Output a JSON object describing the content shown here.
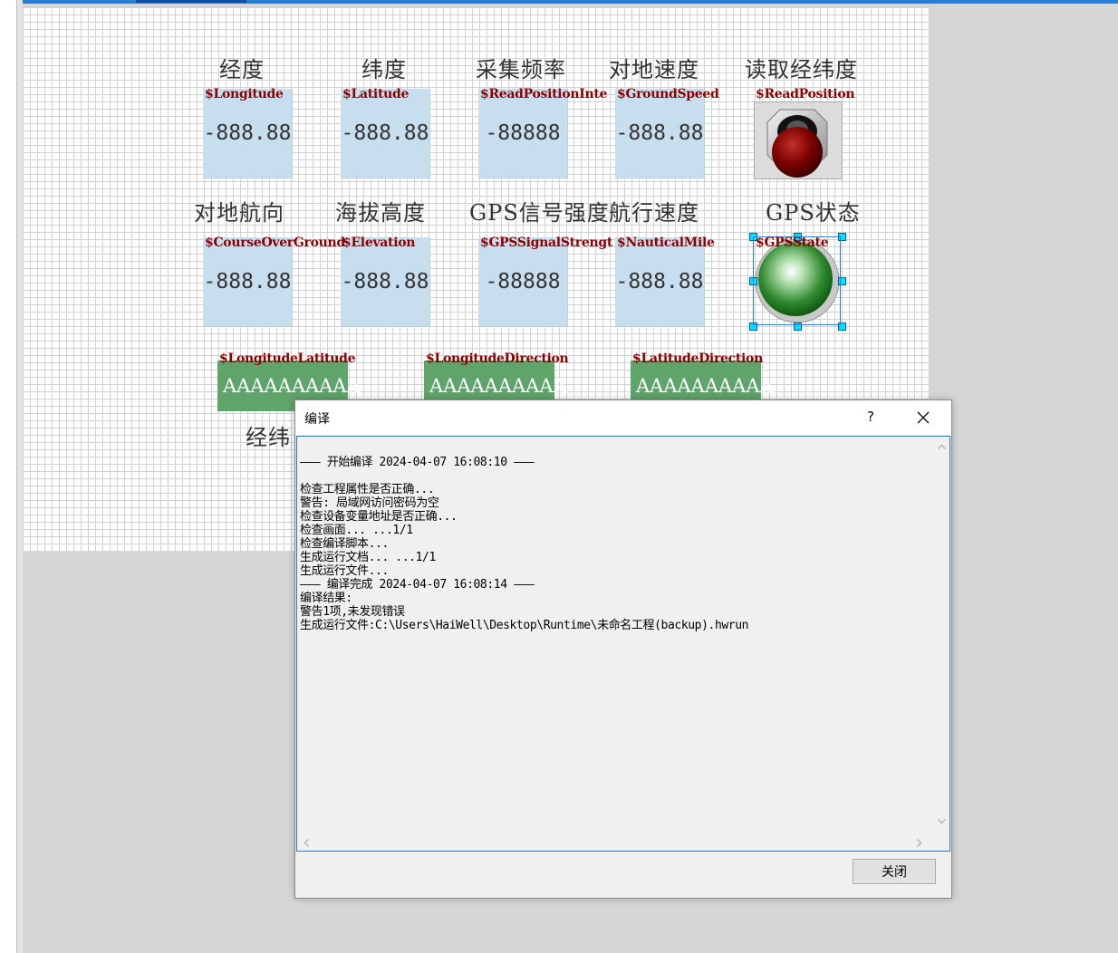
{
  "row1": {
    "captions": [
      "经度",
      "纬度",
      "采集频率",
      "对地速度",
      "读取经纬度"
    ],
    "tags": [
      "$Longitude",
      "$Latitude",
      "$ReadPositionInte",
      "$GroundSpeed",
      "$ReadPosition"
    ],
    "values": [
      "-888.88",
      "-888.88",
      "-88888",
      "-888.88"
    ]
  },
  "row2": {
    "captions": [
      "对地航向",
      "海拔高度",
      "GPS信号强度",
      "航行速度",
      "GPS状态"
    ],
    "tags": [
      "$CourseOverGround",
      "$Elevation",
      "$GPSSignalStrengt",
      "$NauticalMile",
      "$GPSState"
    ],
    "values": [
      "-888.88",
      "-888.88",
      "-88888",
      "-888.88"
    ]
  },
  "row3": {
    "tags": [
      "$LongitudeLatitude",
      "$LongitudeDirection",
      "$LatitudeDirection"
    ],
    "values": [
      "AAAAAAAAAA",
      "AAAAAAAAAA",
      "AAAAAAAAAA"
    ],
    "caption_partial": "经纬"
  },
  "dialog": {
    "title": "编译",
    "help": "?",
    "close_button": "关闭",
    "log": [
      "——— 开始编译 2024-04-07 16:08:10 ———",
      "",
      "检查工程属性是否正确...",
      "警告: 局域网访问密码为空",
      "检查设备变量地址是否正确...",
      "检查画面... ...1/1",
      "检查编译脚本...",
      "生成运行文档... ...1/1",
      "生成运行文件...",
      "——— 编译完成 2024-04-07 16:08:14 ———",
      "编译结果:",
      "警告1项,未发现错误",
      "生成运行文件:C:\\Users\\HaiWell\\Desktop\\Runtime\\未命名工程(backup).hwrun"
    ]
  },
  "colors": {
    "value_box": "#c7deef",
    "string_box": "#5fa46a",
    "tag_text": "#8b0000",
    "accent": "#1f7ad6"
  }
}
